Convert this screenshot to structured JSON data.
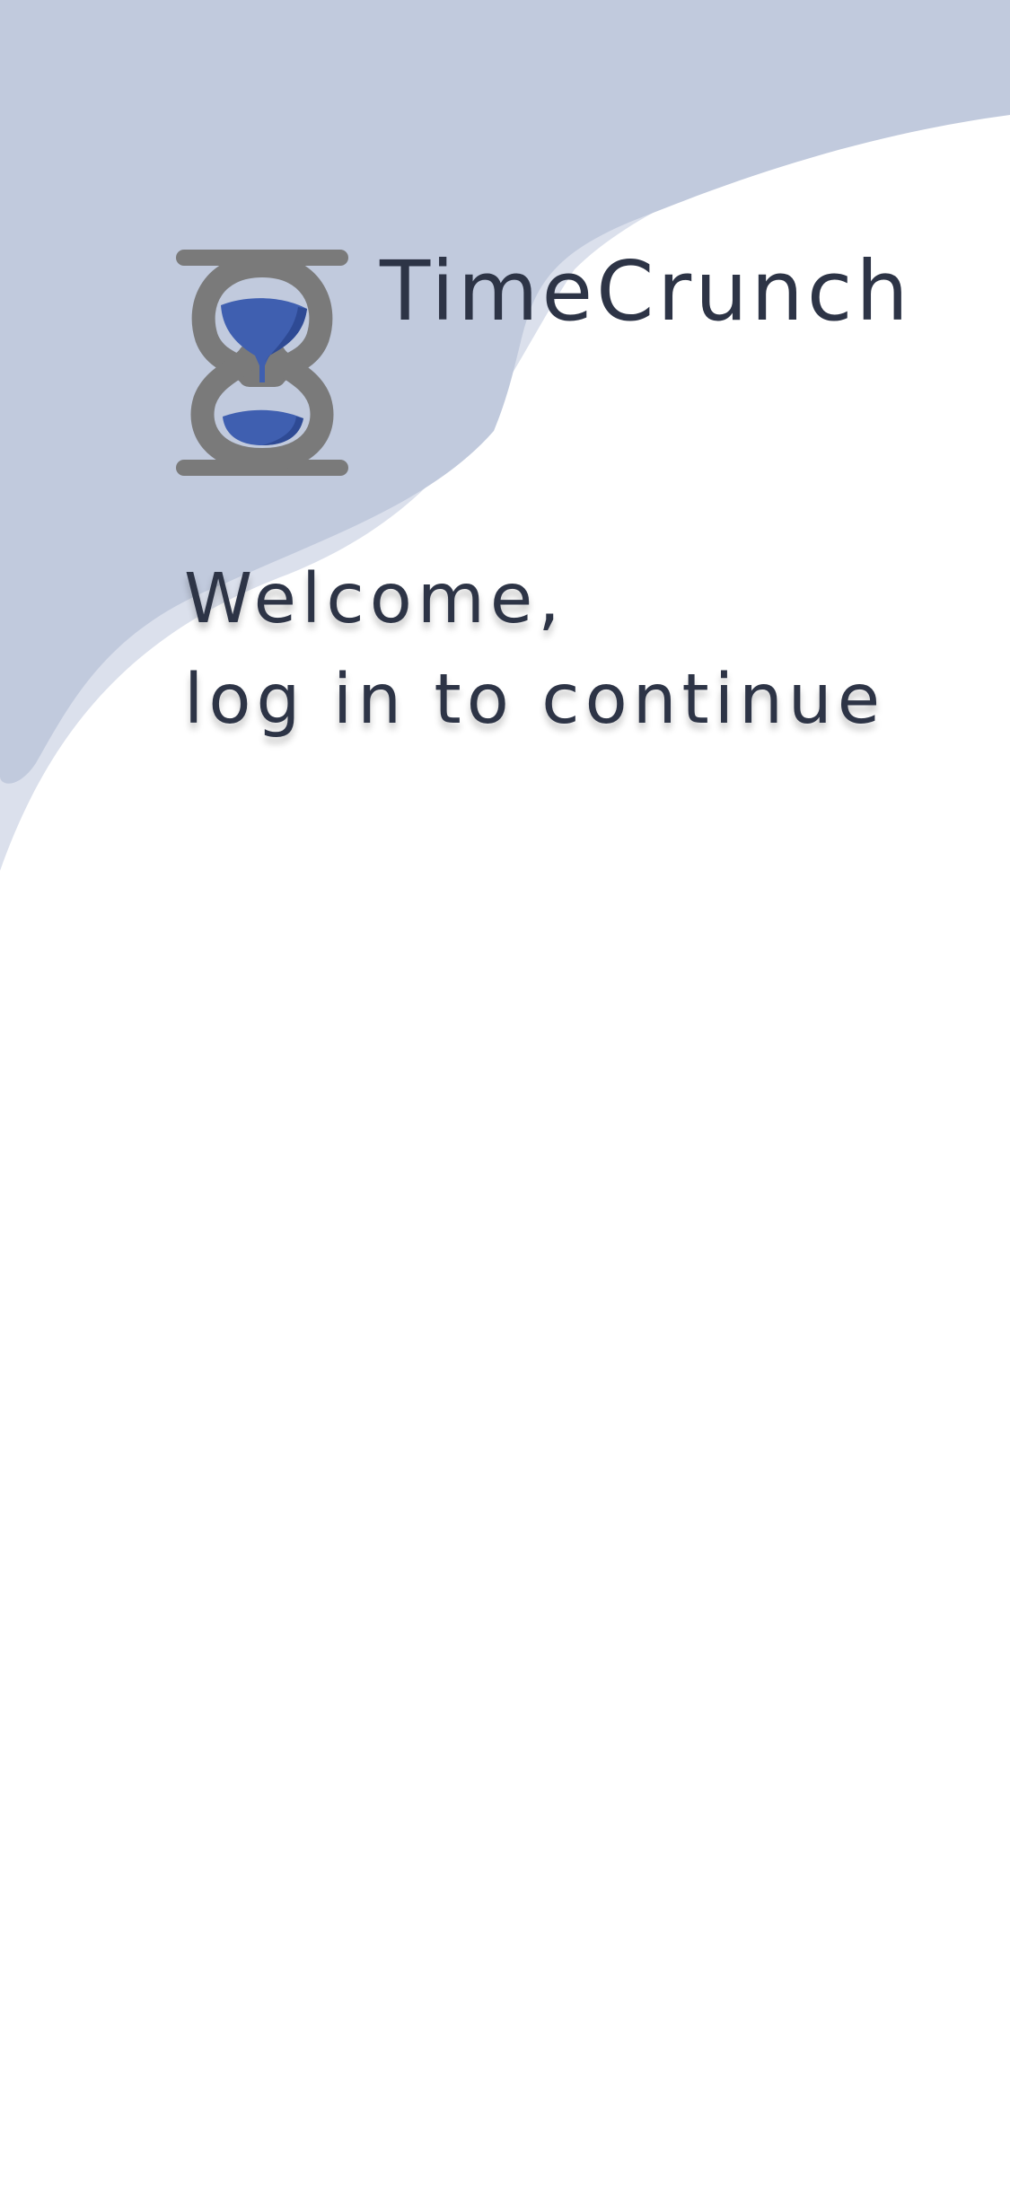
{
  "app": {
    "name": "TimeCrunch"
  },
  "logo": {
    "icon": "hourglass-icon",
    "frame_color": "#7a7a7a",
    "sand_color": "#3f5fb0"
  },
  "greeting": {
    "line1": "Welcome,",
    "line2": "log in to continue"
  },
  "colors": {
    "background": "#ffffff",
    "wave_primary": "#c1cadd",
    "wave_secondary": "#dbe0ec",
    "text": "#2d3446"
  }
}
